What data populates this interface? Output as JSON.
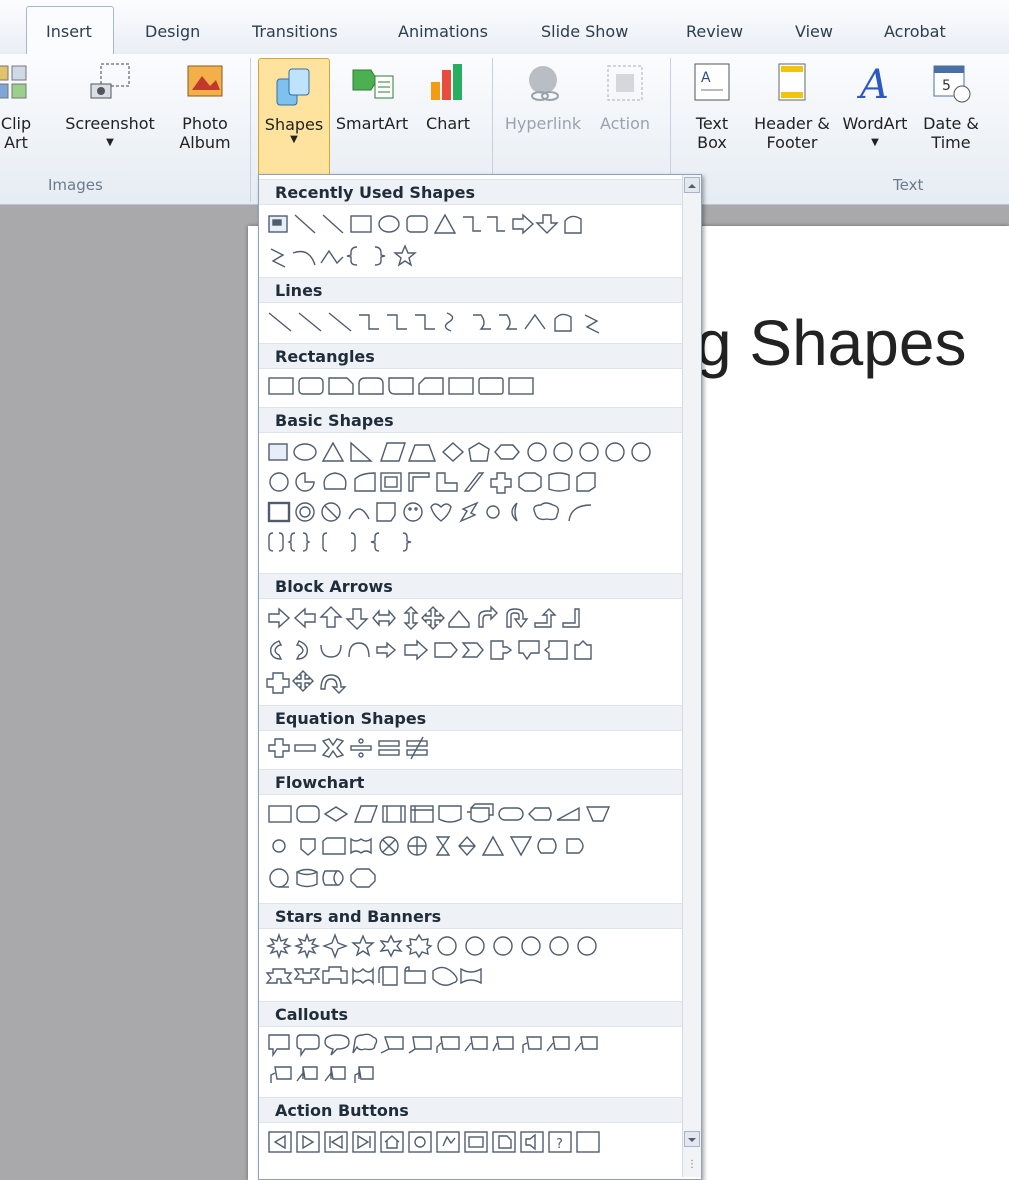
{
  "tabs": [
    "Insert",
    "Design",
    "Transitions",
    "Animations",
    "Slide Show",
    "Review",
    "View",
    "Acrobat"
  ],
  "ribbon": {
    "clip_art": "Clip Art",
    "screenshot": "Screenshot",
    "photo_album": "Photo Album",
    "shapes": "Shapes",
    "smartart": "SmartArt",
    "chart": "Chart",
    "hyperlink": "Hyperlink",
    "action": "Action",
    "text_box": "Text Box",
    "header_footer": "Header & Footer",
    "wordart": "WordArt",
    "date_time": "Date & Time",
    "groups": {
      "images": "Images",
      "text": "Text"
    }
  },
  "slide_title": "g Shapes",
  "gallery": {
    "sections": [
      "Recently Used Shapes",
      "Lines",
      "Rectangles",
      "Basic Shapes",
      "Block Arrows",
      "Equation Shapes",
      "Flowchart",
      "Stars and Banners",
      "Callouts",
      "Action Buttons"
    ]
  },
  "colors": {
    "active_button": "#fde39d",
    "ribbon_text": "#222222",
    "slide_bg": "#a9a9ab"
  }
}
